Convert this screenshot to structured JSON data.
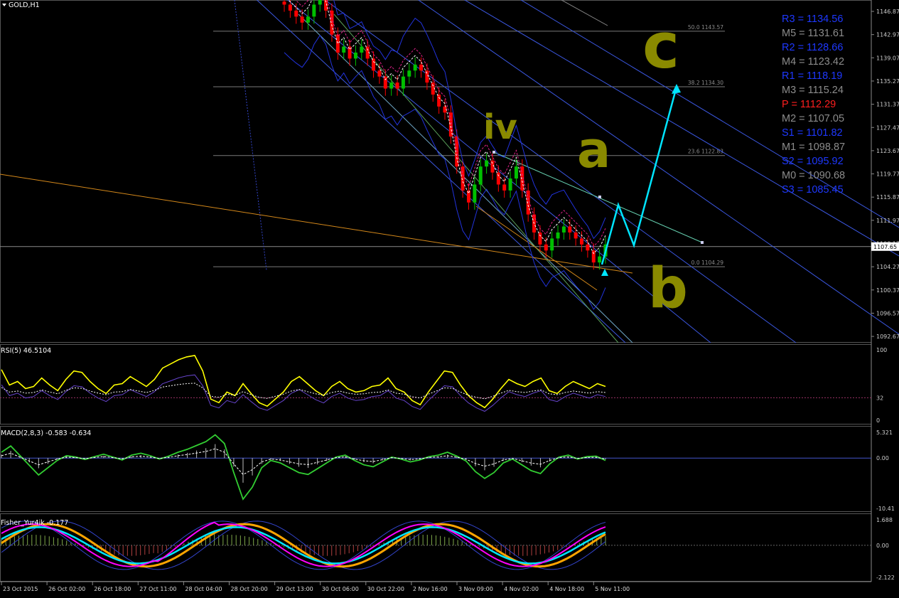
{
  "symbol_label": "GOLD,H1",
  "colors": {
    "background": "#000000",
    "grid": "#3a3a3a",
    "bull_candle": "#00c000",
    "bear_candle": "#ff0000",
    "channel": "#4a6bff",
    "fib": "#7a7a7a",
    "annotation": "#00e5ff",
    "wave_label": "#8a8a00",
    "rsi": "#ffff00",
    "macd": "#32cd32",
    "fisher_fast": "#ff00ff",
    "fisher_slow": "#ffa500",
    "fisher_mid": "#00e5ff"
  },
  "pivots": [
    {
      "label": "R3 = 1134.56",
      "color": "#1e38ff"
    },
    {
      "label": "M5 = 1131.61",
      "color": "#8c8c8c"
    },
    {
      "label": "R2 = 1128.66",
      "color": "#1e38ff"
    },
    {
      "label": "M4 = 1123.42",
      "color": "#8c8c8c"
    },
    {
      "label": "R1 = 1118.19",
      "color": "#1e38ff"
    },
    {
      "label": "M3 = 1115.24",
      "color": "#8c8c8c"
    },
    {
      "label": "P  = 1112.29",
      "color": "#ff1e1e"
    },
    {
      "label": "M2 = 1107.05",
      "color": "#8c8c8c"
    },
    {
      "label": "S1 = 1101.82",
      "color": "#1e38ff"
    },
    {
      "label": "M1 = 1098.87",
      "color": "#8c8c8c"
    },
    {
      "label": "S2 = 1095.92",
      "color": "#1e38ff"
    },
    {
      "label": "M0 = 1090.68",
      "color": "#8c8c8c"
    },
    {
      "label": "S3 = 1085.45",
      "color": "#1e38ff"
    }
  ],
  "wave_labels": [
    "iv",
    "a",
    "b",
    "c"
  ],
  "chart_data": [
    {
      "type": "line",
      "name_label": "GOLD,H1",
      "y_ticks": [
        "1146.87",
        "1142.97",
        "1139.07",
        "1135.27",
        "1131.37",
        "1127.47",
        "1123.67",
        "1119.77",
        "1115.87",
        "1111.97",
        "1108.17",
        "1104.27",
        "1100.37",
        "1096.57",
        "1092.67"
      ],
      "current_price": "1107.65",
      "x_ticks": [
        "23 Oct 2015",
        "26 Oct 02:00",
        "26 Oct 18:00",
        "27 Oct 11:00",
        "28 Oct 04:00",
        "28 Oct 20:00",
        "29 Oct 13:00",
        "30 Oct 06:00",
        "30 Oct 22:00",
        "2 Nov 16:00",
        "3 Nov 09:00",
        "4 Nov 02:00",
        "4 Nov 18:00",
        "5 Nov 11:00"
      ],
      "fib_levels": [
        {
          "level": "50.0",
          "price": "1143.57"
        },
        {
          "level": "38.2",
          "price": "1134.30"
        },
        {
          "level": "23.6",
          "price": "1122.83"
        },
        {
          "level": "0.0",
          "price": "1104.29"
        }
      ],
      "close_path": [
        1148,
        1147,
        1146,
        1145,
        1146,
        1148,
        1149,
        1147,
        1143,
        1140,
        1141,
        1139,
        1140,
        1141,
        1139,
        1137,
        1136,
        1134,
        1135,
        1134,
        1136,
        1137,
        1138,
        1137,
        1135,
        1133,
        1131,
        1130,
        1126,
        1121,
        1117,
        1115,
        1118,
        1121,
        1122,
        1120,
        1118,
        1117,
        1119,
        1121,
        1117,
        1113,
        1110,
        1108,
        1107,
        1109,
        1110,
        1111,
        1110,
        1109,
        1108,
        1107,
        1105,
        1106,
        1108
      ]
    },
    {
      "type": "line",
      "name_label": "RSI(5) 46.5104",
      "y_ticks": [
        "100",
        "32",
        "0"
      ],
      "values": [
        72,
        50,
        55,
        45,
        48,
        60,
        50,
        42,
        58,
        70,
        68,
        55,
        45,
        38,
        50,
        52,
        62,
        55,
        48,
        58,
        74,
        80,
        86,
        90,
        92,
        70,
        30,
        25,
        40,
        35,
        52,
        38,
        25,
        20,
        30,
        40,
        55,
        62,
        52,
        42,
        35,
        48,
        55,
        45,
        40,
        42,
        48,
        50,
        60,
        45,
        40,
        28,
        22,
        40,
        55,
        70,
        68,
        50,
        35,
        25,
        18,
        30,
        45,
        58,
        52,
        48,
        55,
        60,
        42,
        38,
        48,
        55,
        50,
        45,
        52,
        48
      ]
    },
    {
      "type": "bar",
      "name_label": "MACD(2,8,3) -0.583 -0.634",
      "y_ticks": [
        "5.321",
        "0.00",
        "-10.41"
      ],
      "values": [
        1.2,
        2.5,
        0.5,
        -1.5,
        -3.5,
        -2.0,
        -0.5,
        0.5,
        0.2,
        -0.3,
        0.3,
        0.8,
        0.2,
        -0.4,
        0.6,
        1.0,
        0.5,
        -0.2,
        0.4,
        1.2,
        1.8,
        2.6,
        3.4,
        4.8,
        3.0,
        -3.0,
        -8.5,
        -6.0,
        -2.0,
        -0.5,
        -1.0,
        -2.0,
        -3.0,
        -3.4,
        -2.2,
        -1.0,
        0.2,
        0.6,
        -0.5,
        -1.4,
        -1.8,
        -0.8,
        0.2,
        -0.2,
        -0.8,
        -0.4,
        0.3,
        0.6,
        1.2,
        0.4,
        -0.6,
        -2.8,
        -4.2,
        -3.0,
        -1.0,
        -0.2,
        -1.4,
        -2.6,
        -3.2,
        -1.2,
        0.2,
        0.6,
        -0.2,
        0.3,
        0.4,
        -0.5
      ]
    },
    {
      "type": "line",
      "name_label": "Fisher_Yur4ik -0.177",
      "y_ticks": [
        "1.688",
        "0.00",
        "-2.122"
      ]
    }
  ]
}
